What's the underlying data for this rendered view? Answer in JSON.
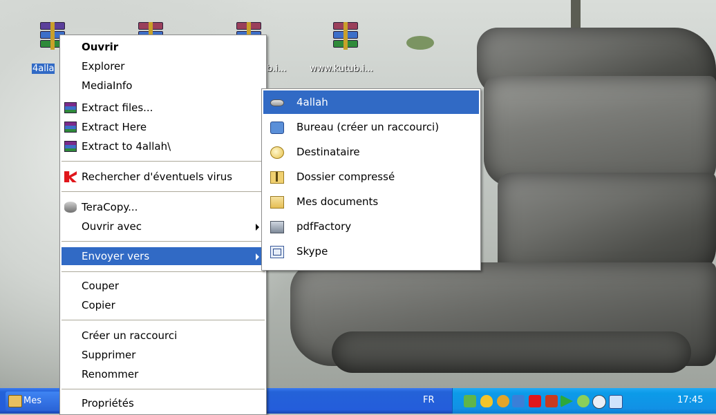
{
  "desktop": {
    "icons": [
      {
        "label": "4alla",
        "selected": true
      },
      {
        "label": "",
        "selected": false
      },
      {
        "label": "b.i...",
        "selected": false
      },
      {
        "label": "www.kutub.i...",
        "selected": false
      }
    ]
  },
  "context_menu": {
    "items": [
      {
        "label": "Ouvrir",
        "icon": "none"
      },
      {
        "label": "Explorer",
        "icon": "none"
      },
      {
        "label": "MediaInfo",
        "icon": "none"
      },
      {
        "label": "Extract files...",
        "icon": "winrar-icon"
      },
      {
        "label": "Extract Here",
        "icon": "winrar-icon"
      },
      {
        "label": "Extract to 4allah\\",
        "icon": "winrar-icon"
      },
      {
        "label": "Rechercher d'éventuels virus",
        "icon": "kaspersky-icon"
      },
      {
        "label": "TeraCopy...",
        "icon": "teracopy-icon"
      },
      {
        "label": "Ouvrir avec",
        "icon": "none"
      },
      {
        "label": "Envoyer vers",
        "icon": "none"
      },
      {
        "label": "Couper",
        "icon": "none"
      },
      {
        "label": "Copier",
        "icon": "none"
      },
      {
        "label": "Créer un raccourci",
        "icon": "none"
      },
      {
        "label": "Supprimer",
        "icon": "none"
      },
      {
        "label": "Renommer",
        "icon": "none"
      },
      {
        "label": "Propriétés",
        "icon": "none"
      }
    ]
  },
  "send_to_menu": {
    "items": [
      {
        "label": "4allah",
        "icon": "drive-icon"
      },
      {
        "label": "Bureau (créer un raccourci)",
        "icon": "desktop-icon"
      },
      {
        "label": "Destinataire",
        "icon": "mail-recipient-icon"
      },
      {
        "label": "Dossier compressé",
        "icon": "zip-folder-icon"
      },
      {
        "label": "Mes documents",
        "icon": "my-documents-icon"
      },
      {
        "label": "pdfFactory",
        "icon": "printer-icon"
      },
      {
        "label": "Skype",
        "icon": "skype-icon"
      }
    ]
  },
  "taskbar": {
    "task_label": "Mes",
    "language": "FR",
    "clock": "17:45"
  },
  "colors": {
    "highlight": "#316ac5",
    "taskbar": "#245ddb",
    "tray": "#0c9be8"
  }
}
